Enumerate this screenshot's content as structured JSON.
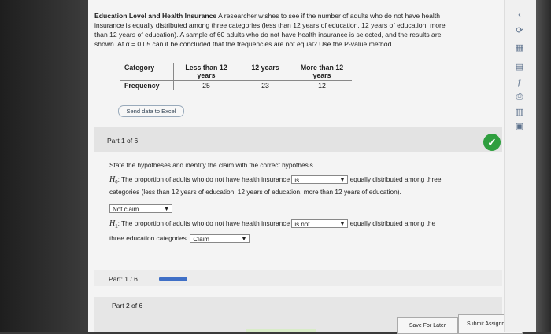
{
  "problem": {
    "title": "Education Level and Health Insurance",
    "line1": " A researcher wishes to see if the number of adults who do not have health",
    "line2": "insurance is equally distributed among three categories (less than 12 years of education, 12 years of education, more",
    "line3": "than 12 years of education). A sample of 60 adults who do not have health insurance is selected, and the results are",
    "line4": "shown. At α = 0.05 can it be concluded that the frequencies are not equal? Use the P-value method."
  },
  "table": {
    "category_label": "Category",
    "frequency_label": "Frequency",
    "columns": [
      "Less than 12 years",
      "12 years",
      "More than 12 years"
    ],
    "values": [
      "25",
      "23",
      "12"
    ]
  },
  "excel_button": "Send data to Excel",
  "part1": {
    "label": "Part 1 of 6",
    "instruction": "State the hypotheses and identify the claim with the correct hypothesis.",
    "h0_symbol": "H",
    "h0_sub": "0",
    "h0_prefix": ": The proportion of adults who do not have health insurance",
    "h0_select": "is",
    "h0_suffix": "equally distributed among three",
    "h0_line2": "categories (less than 12 years of education, 12 years of education, more than 12 years of education).",
    "h0_claim": "Not claim",
    "h1_symbol": "H",
    "h1_sub": "1",
    "h1_prefix": ": The proportion of adults who do not have health insurance",
    "h1_select": "is not",
    "h1_suffix": "equally distributed among the",
    "h1_line2": "three education categories.",
    "h1_claim": "Claim"
  },
  "progress": {
    "label": "Part: 1 / 6",
    "fraction": 0.1667
  },
  "part2": {
    "label": "Part 2 of 6"
  },
  "buttons": {
    "save": "Save For Later",
    "submit": "Submit Assignment"
  },
  "toolbar_icons": [
    "chevron-icon",
    "refresh-icon",
    "calculator-icon",
    "table-icon",
    "formula-icon",
    "print-icon",
    "chart-icon",
    "grid-icon"
  ],
  "colors": {
    "check": "#2e9e3e",
    "progress": "#3f6fc6"
  }
}
